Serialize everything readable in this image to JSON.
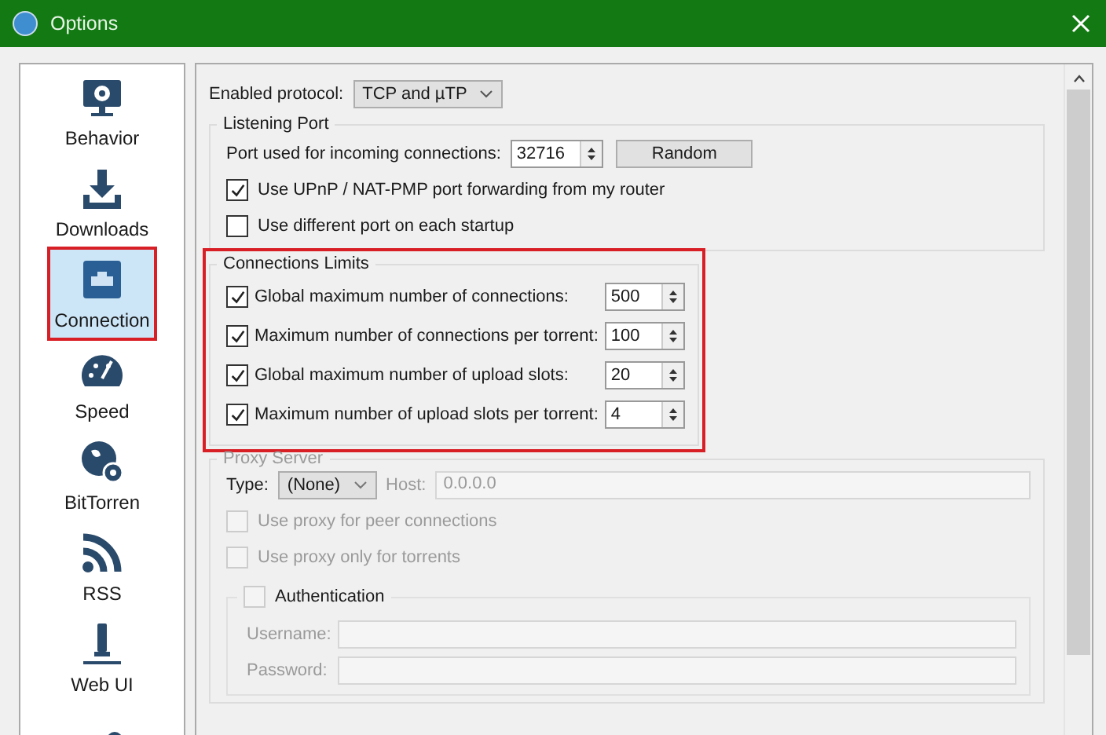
{
  "window": {
    "title": "Options"
  },
  "sidebar": {
    "items": [
      {
        "kind": "monitor",
        "label": "Behavior",
        "selected": false,
        "highlighted": false
      },
      {
        "kind": "download",
        "label": "Downloads",
        "selected": false,
        "highlighted": false
      },
      {
        "kind": "network",
        "label": "Connection",
        "selected": true,
        "highlighted": true
      },
      {
        "kind": "gauge",
        "label": "Speed",
        "selected": false,
        "highlighted": false
      },
      {
        "kind": "globe",
        "label": "BitTorren",
        "selected": false,
        "highlighted": false
      },
      {
        "kind": "rss",
        "label": "RSS",
        "selected": false,
        "highlighted": false
      },
      {
        "kind": "plug",
        "label": "Web UI",
        "selected": false,
        "highlighted": false
      },
      {
        "kind": "gears",
        "selected": false,
        "highlighted": false
      }
    ]
  },
  "protocol": {
    "label": "Enabled protocol:",
    "value": "TCP and µTP"
  },
  "listening_port": {
    "title": "Listening Port",
    "port_label": "Port used for incoming connections:",
    "port_value": "32716",
    "button": "Random",
    "checkboxes": [
      {
        "label": "Use UPnP / NAT-PMP port forwarding from my router",
        "checked": true
      },
      {
        "label": "Use different port on each startup",
        "checked": false
      }
    ]
  },
  "connection_limits": {
    "title": "Connections Limits",
    "highlighted": true,
    "rows": [
      {
        "label": "Global maximum number of connections:",
        "checked": true,
        "value": "500"
      },
      {
        "label": "Maximum number of connections per torrent:",
        "checked": true,
        "value": "100"
      },
      {
        "label": "Global maximum number of upload slots:",
        "checked": true,
        "value": "20"
      },
      {
        "label": "Maximum number of upload slots per torrent:",
        "checked": true,
        "value": "4"
      }
    ]
  },
  "proxy": {
    "title": "Proxy Server",
    "disabled": true,
    "type_label": "Type:",
    "type_value": "(None)",
    "host_label": "Host:",
    "host_value": "0.0.0.0",
    "checkboxes": [
      {
        "label": "Use proxy for peer connections",
        "checked": false
      },
      {
        "label": "Use proxy only for torrents",
        "checked": false
      }
    ],
    "authentication": {
      "label": "Authentication",
      "checked": false,
      "fields": [
        {
          "label": "Username:"
        },
        {
          "label": "Password:"
        }
      ]
    }
  }
}
